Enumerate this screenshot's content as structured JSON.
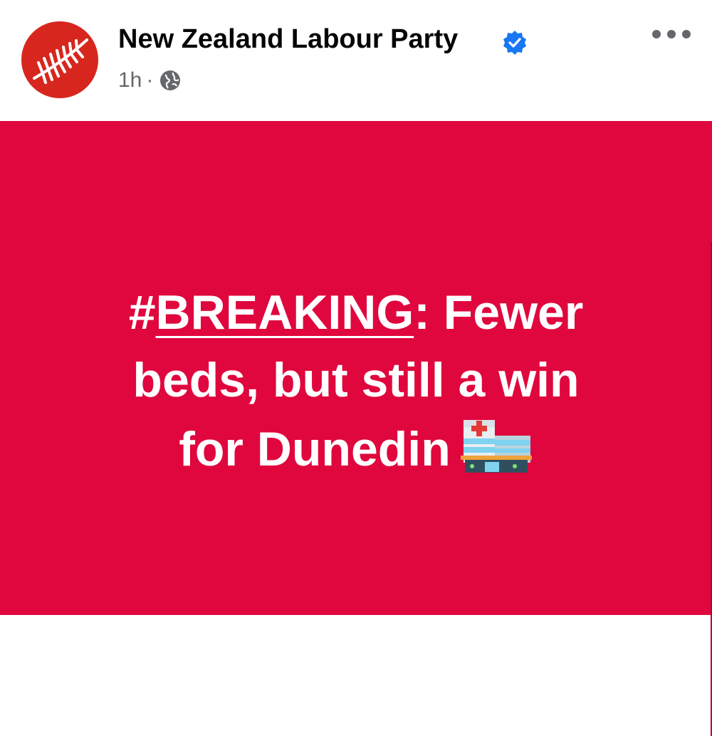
{
  "post": {
    "author": "New Zealand Labour Party",
    "time": "1h",
    "separator": "·",
    "verified": true,
    "audience_icon": "globe-icon",
    "menu_icon": "more-options-icon"
  },
  "image": {
    "background": "#e0073e",
    "headline": {
      "prefix": "#",
      "tag": "BREAKING",
      "rest_line1": ": Fewer",
      "line2": "beds, but still a win",
      "line3": "for Dunedin"
    },
    "emoji": "hospital-icon"
  },
  "colors": {
    "brand": "#d7261e",
    "verified_blue": "#1877f2",
    "secondary_text": "#65676b"
  }
}
